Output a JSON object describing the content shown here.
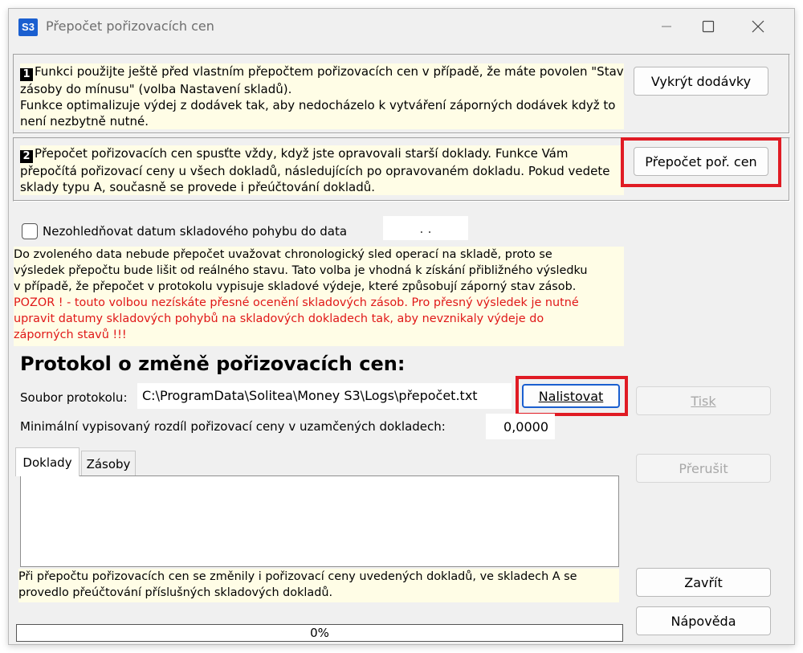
{
  "window": {
    "app_icon_text": "S3",
    "title": "Přepočet pořizovacích cen"
  },
  "section1": {
    "number": "1",
    "text_line1": "Funkci použijte ještě před vlastním přepočtem pořizovacích cen v případě, že máte povolen \"Stav",
    "text_line2": "zásoby do mínusu\" (volba Nastavení skladů).",
    "text_line3": "Funkce optimalizuje výdej z dodávek tak, aby nedocházelo k vytváření záporných dodávek když to",
    "text_line4": "není nezbytně nutné.",
    "button": "Vykrýt dodávky"
  },
  "section2": {
    "number": "2",
    "text_line1": "Přepočet pořizovacích cen spusťte vždy, když jste opravovali starší doklady. Funkce Vám",
    "text_line2": "přepočítá pořizovací ceny u všech dokladů, následujících po opravovaném dokladu. Pokud vedete",
    "text_line3": "sklady typu A, současně se provede i přeúčtování dokladů.",
    "button": "Přepočet poř. cen"
  },
  "options": {
    "checkbox_label": "Nezohledňovat datum skladového pohybu do data",
    "date_value": ". .",
    "note_line1": "Do zvoleného data nebude přepočet uvažovat chronologický sled operací na skladě, proto se",
    "note_line2": "výsledek přepočtu bude lišit od reálného stavu. Tato volba je vhodná k získání přibližného výsledku",
    "note_line3": "v případě, že přepočet v protokolu vypisuje skladové výdeje, které způsobují záporný stav zásob.",
    "warn_line1": "POZOR ! - touto volbou nezískáte přesné ocenění skladových zásob. Pro přesný výsledek je nutné",
    "warn_line2": "upravit datumy skladových pohybů na skladových dokladech tak, aby nevznikaly výdeje do",
    "warn_line3": "záporných stavů !!!"
  },
  "protocol": {
    "heading": "Protokol o změně pořizovacích cen:",
    "file_label": "Soubor protokolu:",
    "file_value": "C:\\ProgramData\\Solitea\\Money S3\\Logs\\přepočet.txt",
    "browse_button": "Nalistovat",
    "min_diff_label": "Minimální vypisovaný rozdíl pořizovací ceny v uzamčených dokladech:",
    "min_diff_value": "0,0000"
  },
  "tabs": [
    {
      "label": "Doklady"
    },
    {
      "label": "Zásoby"
    }
  ],
  "footer": {
    "note_line1": "Při přepočtu pořizovacích cen se změnily i pořizovací ceny uvedených dokladů, ve skladech A se",
    "note_line2": "provedlo přeúčtování příslušných skladových dokladů.",
    "progress_text": "0%",
    "progress_fraction": 0
  },
  "buttons": {
    "print": "Tisk",
    "interrupt": "Přerušit",
    "close": "Zavřít",
    "help": "Nápověda"
  },
  "colors": {
    "highlight": "#e01b24",
    "info_bg": "#fffde6",
    "warning_text": "#e01818",
    "accent": "#1a5fd0"
  }
}
